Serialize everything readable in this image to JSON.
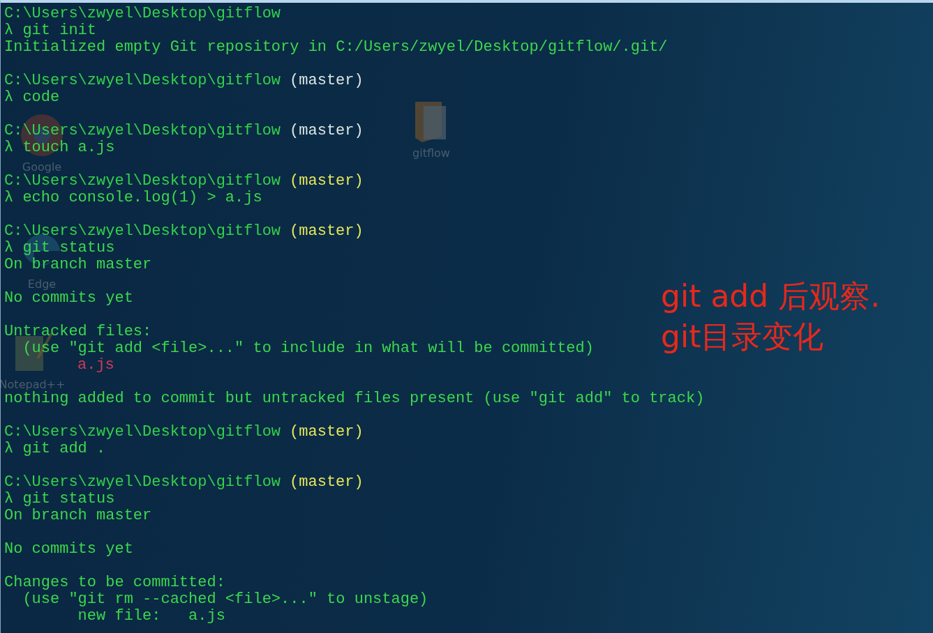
{
  "desktop_icons": [
    {
      "kind": "browser",
      "label_lines": [
        "Google"
      ]
    },
    {
      "kind": "edge",
      "label_lines": [
        "Edge"
      ]
    },
    {
      "kind": "notepad",
      "label_lines": [
        "Notepad++"
      ]
    },
    {
      "kind": "folder",
      "label_lines": [
        "gitflow"
      ]
    }
  ],
  "terminal": {
    "lines": [
      {
        "kind": "line",
        "segments": [
          {
            "kind": "path",
            "text": "C:\\Users\\zwyel\\Desktop\\gitflow"
          }
        ]
      },
      {
        "kind": "line",
        "segments": [
          {
            "kind": "command",
            "text": "λ git init"
          }
        ]
      },
      {
        "kind": "line",
        "segments": [
          {
            "kind": "output",
            "text": "Initialized empty Git repository in C:/Users/zwyel/Desktop/gitflow/.git/"
          }
        ]
      },
      {
        "kind": "blank"
      },
      {
        "kind": "line",
        "segments": [
          {
            "kind": "path",
            "text": "C:\\Users\\zwyel\\Desktop\\gitflow"
          },
          {
            "kind": "branch",
            "text": "(master)",
            "color": "#dce8e4"
          }
        ]
      },
      {
        "kind": "line",
        "segments": [
          {
            "kind": "command",
            "text": "λ code"
          }
        ]
      },
      {
        "kind": "blank"
      },
      {
        "kind": "line",
        "segments": [
          {
            "kind": "path",
            "text": "C:\\Users\\zwyel\\Desktop\\gitflow"
          },
          {
            "kind": "branch",
            "text": "(master)",
            "color": "#dce8e4"
          }
        ]
      },
      {
        "kind": "line",
        "segments": [
          {
            "kind": "command",
            "text": "λ touch a.js"
          }
        ]
      },
      {
        "kind": "blank"
      },
      {
        "kind": "line",
        "segments": [
          {
            "kind": "path",
            "text": "C:\\Users\\zwyel\\Desktop\\gitflow"
          },
          {
            "kind": "branch",
            "text": "(master)",
            "color": "#e6e85a"
          }
        ]
      },
      {
        "kind": "line",
        "segments": [
          {
            "kind": "command",
            "text": "λ echo console.log(1) > a.js"
          }
        ]
      },
      {
        "kind": "blank"
      },
      {
        "kind": "line",
        "segments": [
          {
            "kind": "path",
            "text": "C:\\Users\\zwyel\\Desktop\\gitflow"
          },
          {
            "kind": "branch",
            "text": "(master)",
            "color": "#e6e85a"
          }
        ]
      },
      {
        "kind": "line",
        "segments": [
          {
            "kind": "command",
            "text": "λ git status"
          }
        ]
      },
      {
        "kind": "line",
        "segments": [
          {
            "kind": "output",
            "text": "On branch master"
          }
        ]
      },
      {
        "kind": "blank"
      },
      {
        "kind": "line",
        "segments": [
          {
            "kind": "output",
            "text": "No commits yet"
          }
        ]
      },
      {
        "kind": "blank"
      },
      {
        "kind": "line",
        "segments": [
          {
            "kind": "output",
            "text": "Untracked files:"
          }
        ]
      },
      {
        "kind": "line",
        "segments": [
          {
            "kind": "output",
            "text": "  (use \"git add <file>...\" to include in what will be committed)"
          }
        ]
      },
      {
        "kind": "line",
        "segments": [
          {
            "kind": "untracked",
            "text": "a.js"
          }
        ]
      },
      {
        "kind": "blank"
      },
      {
        "kind": "line",
        "segments": [
          {
            "kind": "output",
            "text": "nothing added to commit but untracked files present (use \"git add\" to track)"
          }
        ]
      },
      {
        "kind": "blank"
      },
      {
        "kind": "line",
        "segments": [
          {
            "kind": "path",
            "text": "C:\\Users\\zwyel\\Desktop\\gitflow"
          },
          {
            "kind": "branch",
            "text": "(master)",
            "color": "#e6e85a"
          }
        ]
      },
      {
        "kind": "line",
        "segments": [
          {
            "kind": "command",
            "text": "λ git add ."
          }
        ]
      },
      {
        "kind": "blank"
      },
      {
        "kind": "line",
        "segments": [
          {
            "kind": "path",
            "text": "C:\\Users\\zwyel\\Desktop\\gitflow"
          },
          {
            "kind": "branch",
            "text": "(master)",
            "color": "#e6e85a"
          }
        ]
      },
      {
        "kind": "line",
        "segments": [
          {
            "kind": "command",
            "text": "λ git status"
          }
        ]
      },
      {
        "kind": "line",
        "segments": [
          {
            "kind": "output",
            "text": "On branch master"
          }
        ]
      },
      {
        "kind": "blank"
      },
      {
        "kind": "line",
        "segments": [
          {
            "kind": "output",
            "text": "No commits yet"
          }
        ]
      },
      {
        "kind": "blank"
      },
      {
        "kind": "line",
        "segments": [
          {
            "kind": "output",
            "text": "Changes to be committed:"
          }
        ]
      },
      {
        "kind": "line",
        "segments": [
          {
            "kind": "output",
            "text": "  (use \"git rm --cached <file>...\" to unstage)"
          }
        ]
      },
      {
        "kind": "line",
        "segments": [
          {
            "kind": "output",
            "text": "        new file:   a.js"
          }
        ]
      }
    ]
  },
  "annotation": {
    "lines": [
      "git add 后观察.",
      "git目录变化"
    ]
  }
}
